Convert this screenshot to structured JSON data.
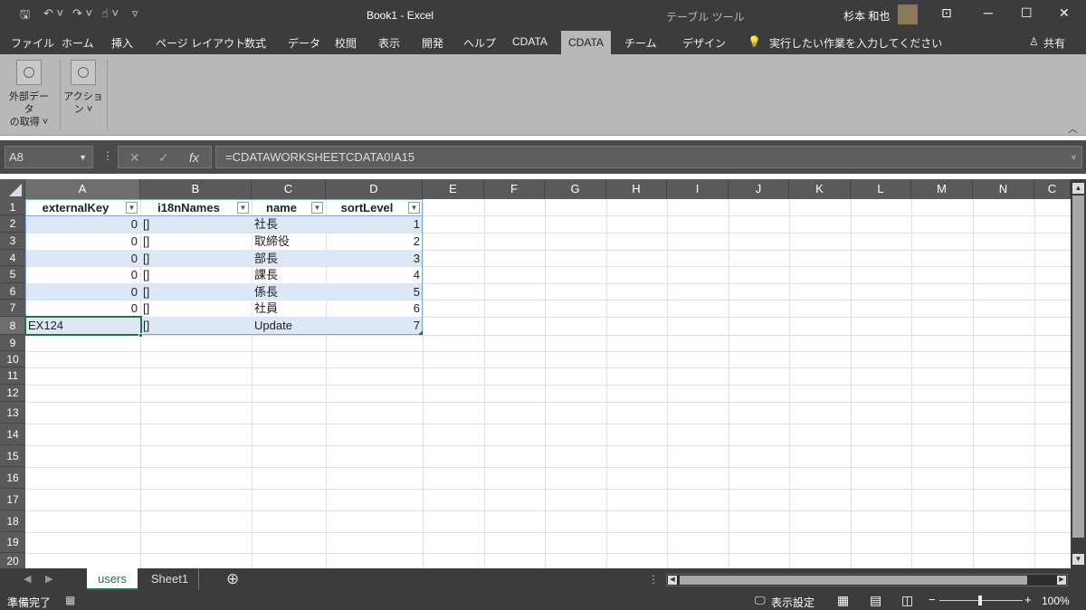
{
  "titlebar": {
    "title": "Book1  -  Excel",
    "context": "テーブル ツール",
    "user": "杉本 和也"
  },
  "tabs": [
    "ファイル",
    "ホーム",
    "挿入",
    "ページ レイアウト",
    "数式",
    "データ",
    "校閲",
    "表示",
    "開発",
    "ヘルプ",
    "CDATA",
    "CDATA",
    "チーム",
    "デザイン"
  ],
  "active_tab_index": 11,
  "tell_me": "実行したい作業を入力してください",
  "share": "共有",
  "ribbon": {
    "btn1": [
      "外部データ",
      "の取得 ˅"
    ],
    "btn2": [
      "アクショ",
      "ン ˅"
    ]
  },
  "formula_bar": {
    "name_box": "A8",
    "formula": "=CDATAWORKSHEETCDATA0!A15",
    "fx": "fx"
  },
  "columns": [
    "A",
    "B",
    "C",
    "D",
    "E",
    "F",
    "G",
    "H",
    "I",
    "J",
    "K",
    "L",
    "M",
    "N",
    "C"
  ],
  "rows": [
    "1",
    "2",
    "3",
    "4",
    "5",
    "6",
    "7",
    "8",
    "9",
    "10",
    "11",
    "12",
    "13",
    "14",
    "15",
    "16",
    "17",
    "18",
    "19",
    "20"
  ],
  "table": {
    "headers": [
      "externalKey",
      "i18nNames",
      "name",
      "sortLevel"
    ],
    "rows": [
      [
        "0",
        "[]",
        "社長",
        "1"
      ],
      [
        "0",
        "[]",
        "取締役",
        "2"
      ],
      [
        "0",
        "[]",
        "部長",
        "3"
      ],
      [
        "0",
        "[]",
        "課長",
        "4"
      ],
      [
        "0",
        "[]",
        "係長",
        "5"
      ],
      [
        "0",
        "[]",
        "社員",
        "6"
      ],
      [
        "EX124",
        "[]",
        "Update",
        "7"
      ]
    ]
  },
  "sheets": [
    "users",
    "Sheet1"
  ],
  "active_sheet": "users",
  "status": {
    "ready": "準備完了",
    "display_settings": "表示設定",
    "zoom": "100%"
  }
}
